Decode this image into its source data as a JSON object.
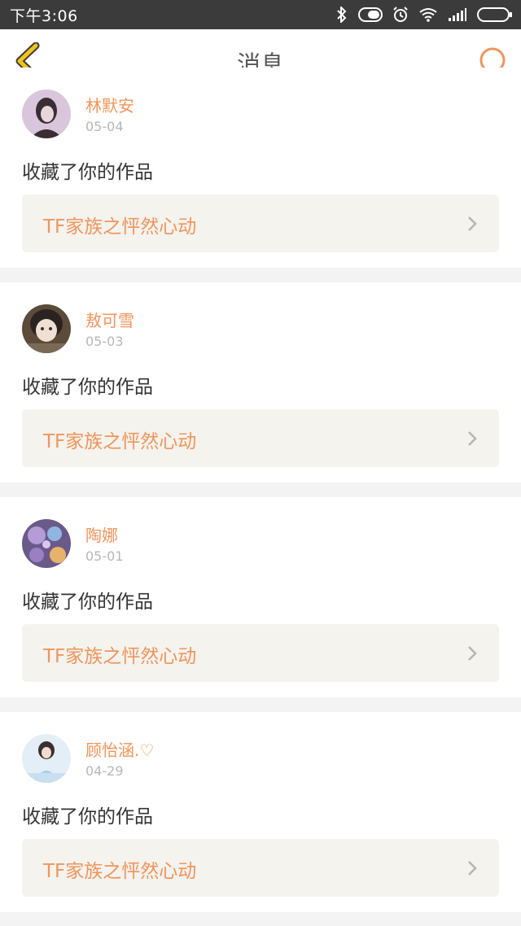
{
  "status_bar": {
    "time": "下午3:06"
  },
  "header": {
    "title": "消息",
    "back_icon": "chevron-left-icon",
    "search_icon": "search-icon",
    "accent_color": "#f0c419",
    "search_color": "#f0955c"
  },
  "messages": [
    {
      "user": "林默安",
      "date": "05-04",
      "action": "收藏了你的作品",
      "work": "TF家族之怦然心动"
    },
    {
      "user": "敖可雪",
      "date": "05-03",
      "action": "收藏了你的作品",
      "work": "TF家族之怦然心动"
    },
    {
      "user": "陶娜",
      "date": "05-01",
      "action": "收藏了你的作品",
      "work": "TF家族之怦然心动"
    },
    {
      "user": "顾怡涵.♡",
      "date": "04-29",
      "action": "收藏了你的作品",
      "work": "TF家族之怦然心动"
    }
  ],
  "colors": {
    "name": "#f0955c",
    "date": "#b7b7b7",
    "work_bg": "#f4f3ee",
    "divider": "#f3f3f3"
  }
}
